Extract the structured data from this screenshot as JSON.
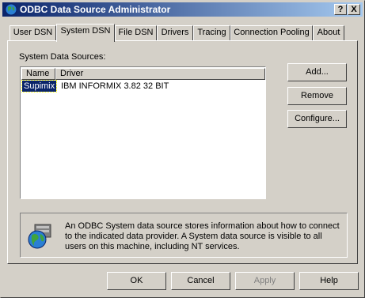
{
  "window": {
    "title": "ODBC Data Source Administrator"
  },
  "titlebar_buttons": {
    "help": "?",
    "close": "X"
  },
  "tabs": [
    {
      "label": "User DSN",
      "active": false
    },
    {
      "label": "System DSN",
      "active": true
    },
    {
      "label": "File DSN",
      "active": false
    },
    {
      "label": "Drivers",
      "active": false
    },
    {
      "label": "Tracing",
      "active": false
    },
    {
      "label": "Connection Pooling",
      "active": false
    },
    {
      "label": "About",
      "active": false
    }
  ],
  "panel": {
    "list_label": "System Data Sources:",
    "columns": [
      "Name",
      "Driver"
    ],
    "rows": [
      {
        "name": "Supimix",
        "driver": "IBM INFORMIX 3.82 32 BIT",
        "selected": true
      }
    ],
    "buttons": {
      "add": "Add...",
      "remove": "Remove",
      "configure": "Configure..."
    },
    "info_text": "An ODBC System data source stores information about how to connect to the indicated data provider.  A System data source is visible to all users on this machine, including NT services."
  },
  "footer": {
    "ok": "OK",
    "cancel": "Cancel",
    "apply": "Apply",
    "help": "Help"
  },
  "colors": {
    "titlebar_start": "#0a246a",
    "titlebar_end": "#a6caf0",
    "face": "#d4d0c8",
    "selection": "#0a246a"
  },
  "icons": {
    "app": "globe-icon",
    "info": "database-globe-icon"
  }
}
